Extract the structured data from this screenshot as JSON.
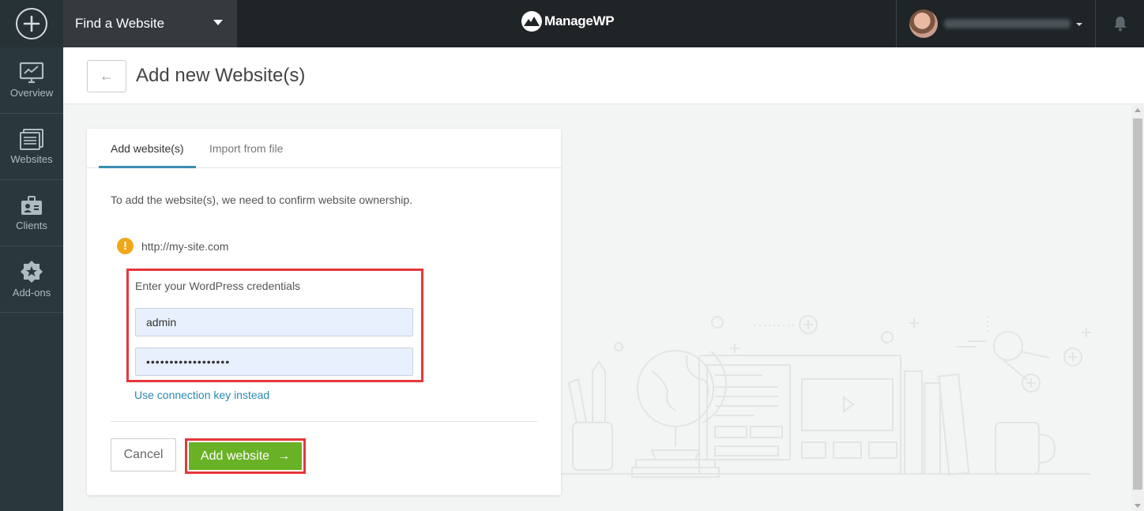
{
  "topbar": {
    "site_selector": "Find a Website",
    "brand": "ManageWP"
  },
  "sidebar": {
    "items": [
      {
        "label": "Overview",
        "icon": "chart-monitor-icon"
      },
      {
        "label": "Websites",
        "icon": "websites-icon"
      },
      {
        "label": "Clients",
        "icon": "clients-icon"
      },
      {
        "label": "Add-ons",
        "icon": "addons-star-icon"
      }
    ]
  },
  "header": {
    "back": "←",
    "title": "Add new Website(s)"
  },
  "card": {
    "tabs": [
      {
        "label": "Add website(s)",
        "active": true
      },
      {
        "label": "Import from file",
        "active": false
      }
    ],
    "intro": "To add the website(s), we need to confirm website ownership.",
    "site_url": "http://my-site.com",
    "warning_symbol": "!",
    "credentials_label": "Enter your WordPress credentials",
    "username_value": "admin",
    "password_value": "••••••••••••••••••",
    "connection_link": "Use connection key instead",
    "cancel_label": "Cancel",
    "add_label": "Add website",
    "add_arrow": "→"
  },
  "colors": {
    "topbar": "#1f2427",
    "sidebar": "#2a383e",
    "primary_green": "#69b125",
    "highlight_red": "#e6373b",
    "link_blue": "#2a8ab4",
    "tab_underline": "#3a8fb0",
    "warning": "#f0a81a"
  }
}
